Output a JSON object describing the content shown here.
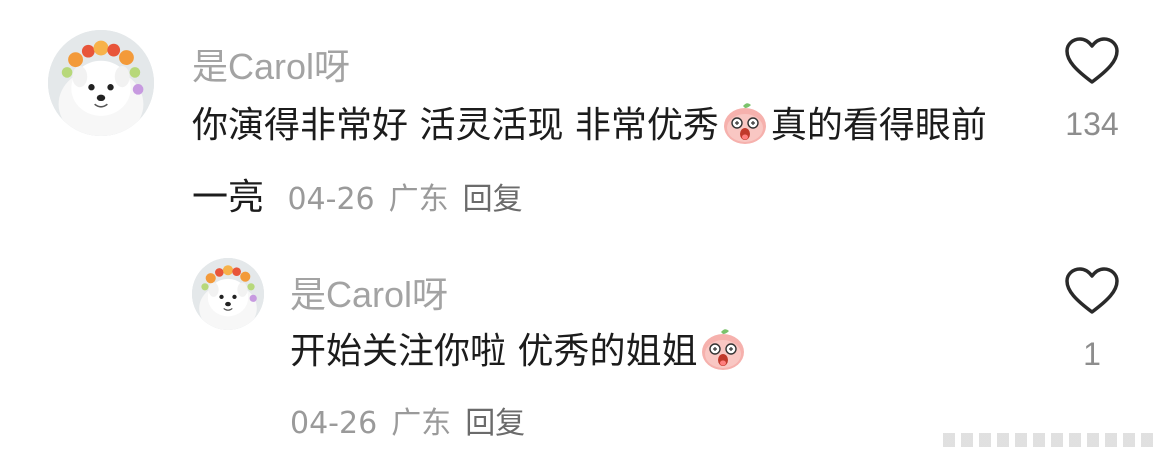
{
  "comments": [
    {
      "username": "是Carol呀",
      "text_parts": [
        "你演得非常好 活灵活现 非常优秀",
        "真的看得眼前一亮"
      ],
      "emoji": "peach-face-emoji",
      "date": "04-26",
      "location": "广东",
      "reply_label": "回复",
      "like_count": "134"
    },
    {
      "username": "是Carol呀",
      "text_parts": [
        "开始关注你啦 优秀的姐姐",
        ""
      ],
      "emoji": "peach-face-emoji",
      "date": "04-26",
      "location": "广东",
      "reply_label": "回复",
      "like_count": "1"
    }
  ],
  "icons": {
    "like": "heart-outline-icon",
    "avatar": "samoyed-flower-crown-avatar"
  },
  "colors": {
    "username": "#a3a3a3",
    "body": "#1c1c1c",
    "meta": "#9a9a9a",
    "heart_stroke": "#2a2a2a",
    "emoji_pink": "#f4a6a6"
  }
}
